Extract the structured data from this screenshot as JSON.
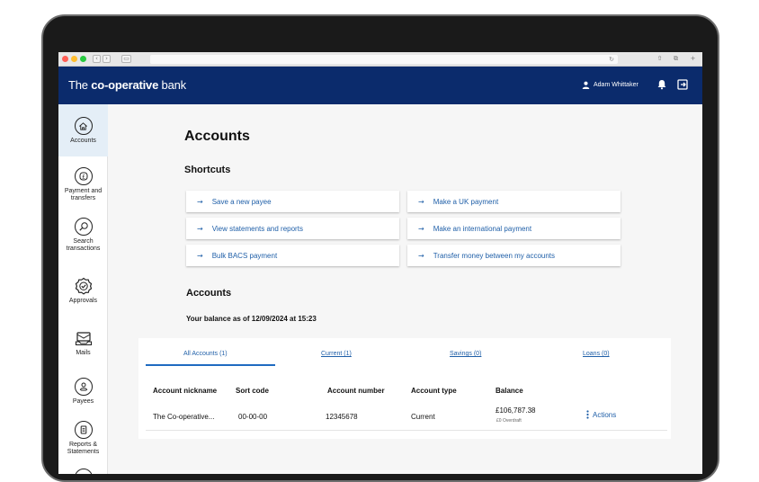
{
  "app": {
    "brand_prefix": "The ",
    "brand_name": "co-operative",
    "brand_suffix": " bank",
    "user_name": "Adam Whittaker"
  },
  "sidebar": {
    "items": [
      {
        "label": "Accounts",
        "icon": "home-icon"
      },
      {
        "label": "Payment and transfers",
        "icon": "pound-coin-icon"
      },
      {
        "label": "Search transactions",
        "icon": "search-icon"
      },
      {
        "label": "Approvals",
        "icon": "check-badge-icon"
      },
      {
        "label": "Mails",
        "icon": "mail-icon"
      },
      {
        "label": "Payees",
        "icon": "person-icon"
      },
      {
        "label": "Reports & Statements",
        "icon": "document-icon"
      }
    ]
  },
  "main": {
    "title": "Accounts",
    "shortcuts_heading": "Shortcuts",
    "shortcuts": [
      "Save a new payee",
      "Make a UK payment",
      "View statements and reports",
      "Make an international payment",
      "Bulk BACS  payment",
      "Transfer money between my accounts"
    ],
    "accounts_heading": "Accounts",
    "balance_text": "Your balance as of 12/09/2024 at 15:23",
    "tabs": [
      "All Accounts (1)",
      "Current (1)",
      "Savings (0)",
      "Loans (0)"
    ],
    "columns": [
      "Account nickname",
      "Sort code",
      "Account number",
      "Account type",
      "Balance"
    ],
    "row": {
      "nickname": "The Co-operative...",
      "sort_code": "00-00-00",
      "account_number": "12345678",
      "account_type": "Current",
      "balance": "£106,787.38",
      "overdraft": "£0 Overdraft",
      "actions": "Actions"
    }
  },
  "colors": {
    "header": "#0b2b6c",
    "link": "#1f5fa8",
    "active_tab_line": "#1f6bc1",
    "sidebar_active": "#e4eef7"
  }
}
